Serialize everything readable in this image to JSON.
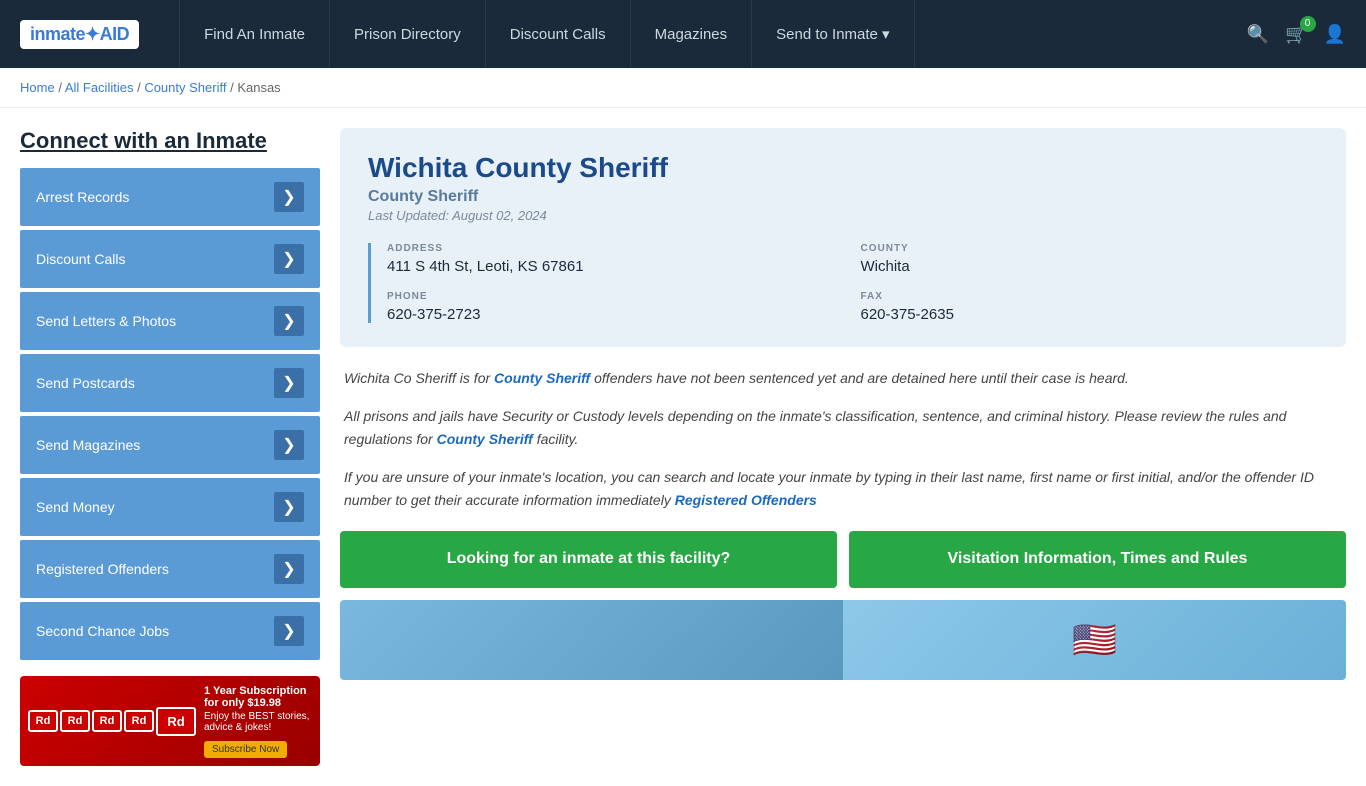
{
  "navbar": {
    "logo_text": "inmate",
    "logo_aid": "AID",
    "links": [
      {
        "id": "find-inmate",
        "label": "Find An Inmate"
      },
      {
        "id": "prison-directory",
        "label": "Prison Directory"
      },
      {
        "id": "discount-calls",
        "label": "Discount Calls"
      },
      {
        "id": "magazines",
        "label": "Magazines"
      },
      {
        "id": "send-to-inmate",
        "label": "Send to Inmate ▾"
      }
    ],
    "cart_count": "0"
  },
  "breadcrumb": {
    "home": "Home",
    "all_facilities": "All Facilities",
    "county_sheriff": "County Sheriff",
    "state": "Kansas"
  },
  "sidebar": {
    "title": "Connect with an Inmate",
    "items": [
      {
        "id": "arrest-records",
        "label": "Arrest Records"
      },
      {
        "id": "discount-calls",
        "label": "Discount Calls"
      },
      {
        "id": "send-letters-photos",
        "label": "Send Letters & Photos"
      },
      {
        "id": "send-postcards",
        "label": "Send Postcards"
      },
      {
        "id": "send-magazines",
        "label": "Send Magazines"
      },
      {
        "id": "send-money",
        "label": "Send Money"
      },
      {
        "id": "registered-offenders",
        "label": "Registered Offenders"
      },
      {
        "id": "second-chance-jobs",
        "label": "Second Chance Jobs"
      }
    ],
    "ad": {
      "logo": "Rd",
      "logo_full": "Reader's digest",
      "promo_line1": "1 Year Subscription for only $19.98",
      "promo_line2": "Enjoy the BEST stories, advice & jokes!",
      "subscribe_label": "Subscribe Now"
    }
  },
  "facility": {
    "name": "Wichita County Sheriff",
    "type": "County Sheriff",
    "last_updated": "Last Updated: August 02, 2024",
    "address_label": "ADDRESS",
    "address_value": "411 S 4th St, Leoti, KS 67861",
    "county_label": "COUNTY",
    "county_value": "Wichita",
    "phone_label": "PHONE",
    "phone_value": "620-375-2723",
    "fax_label": "FAX",
    "fax_value": "620-375-2635"
  },
  "description": {
    "para1": "Wichita Co Sheriff is for County Sheriff offenders have not been sentenced yet and are detained here until their case is heard.",
    "para1_link_text": "County Sheriff",
    "para2": "All prisons and jails have Security or Custody levels depending on the inmate’s classification, sentence, and criminal history. Please review the rules and regulations for County Sheriff facility.",
    "para2_link_text": "County Sheriff",
    "para3": "If you are unsure of your inmate’s location, you can search and locate your inmate by typing in their last name, first name or first initial, and/or the offender ID number to get their accurate information immediately Registered Offenders",
    "para3_link_text": "Registered Offenders"
  },
  "actions": {
    "btn1": "Looking for an inmate at this facility?",
    "btn2": "Visitation Information, Times and Rules"
  }
}
